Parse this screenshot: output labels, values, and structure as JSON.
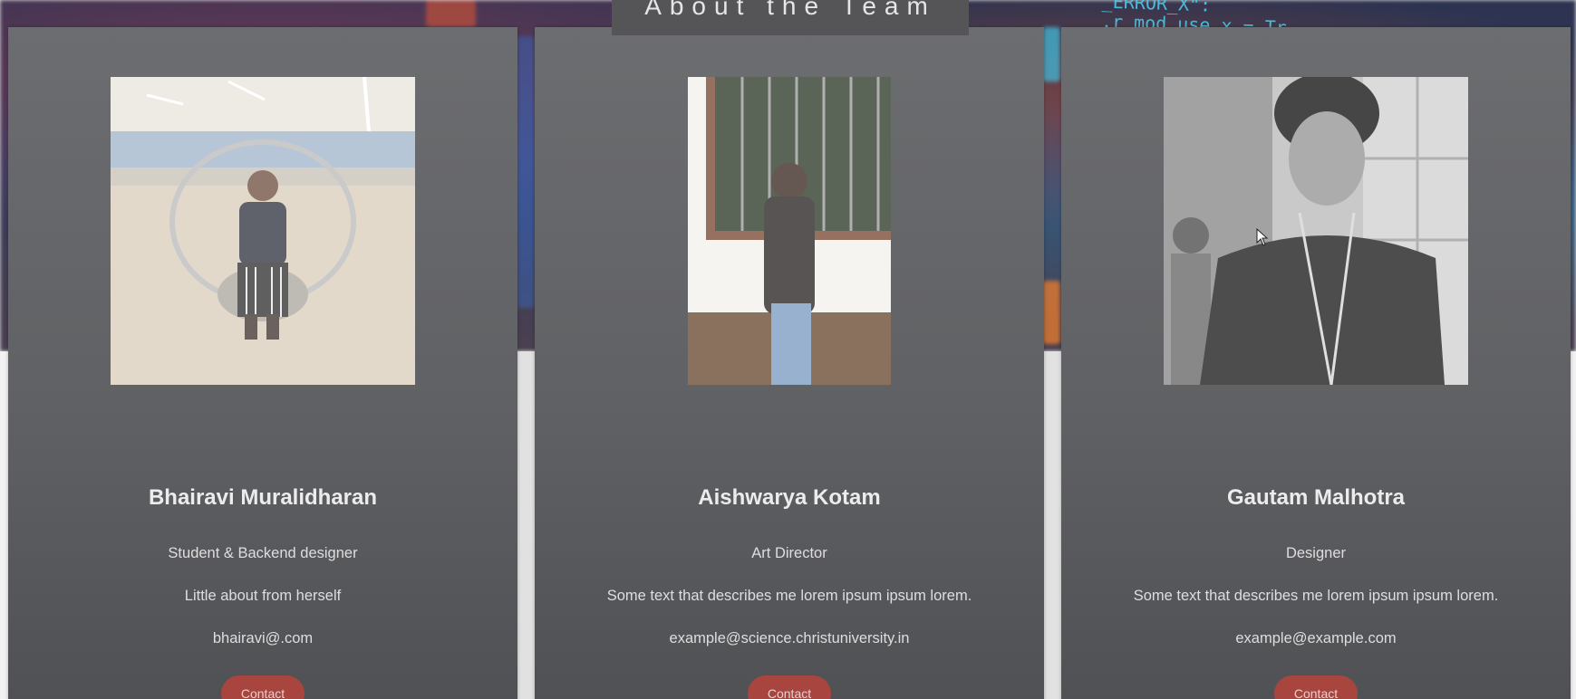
{
  "header": {
    "title": "About the Team",
    "code_text": "_ERROR_X\":\n.r_mod.use_x = Tr\nirror_mo"
  },
  "team": [
    {
      "name": "Bhairavi Muralidharan",
      "role": "Student & Backend designer",
      "description": "Little about from herself",
      "email": "bhairavi@.com",
      "contact_label": "Contact"
    },
    {
      "name": "Aishwarya Kotam",
      "role": "Art Director",
      "description": "Some text that describes me lorem ipsum ipsum lorem.",
      "email": "example@science.christuniversity.in",
      "contact_label": "Contact"
    },
    {
      "name": "Gautam Malhotra",
      "role": "Designer",
      "description": "Some text that describes me lorem ipsum ipsum lorem.",
      "email": "example@example.com",
      "contact_label": "Contact"
    }
  ],
  "colors": {
    "card_background": "#666769",
    "contact_button": "#a9453f",
    "title_bar": "#555557"
  }
}
